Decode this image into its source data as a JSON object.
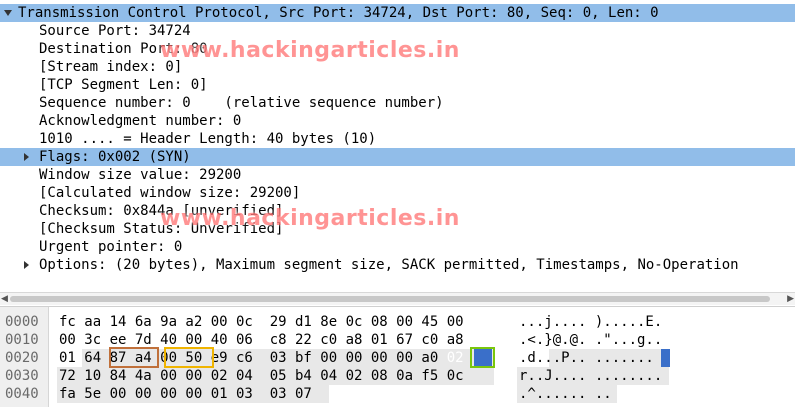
{
  "tree": {
    "rows": [
      {
        "text": "Transmission Control Protocol, Src Port: 34724, Dst Port: 80, Seq: 0, Len: 0",
        "expander": "expanded"
      },
      {
        "text": "Source Port: 34724"
      },
      {
        "text": "Destination Port: 80"
      },
      {
        "text": "[Stream index: 0]"
      },
      {
        "text": "[TCP Segment Len: 0]"
      },
      {
        "text": "Sequence number: 0    (relative sequence number)"
      },
      {
        "text": "Acknowledgment number: 0"
      },
      {
        "text": "1010 .... = Header Length: 40 bytes (10)"
      },
      {
        "text": "Flags: 0x002 (SYN)",
        "expander": "collapsed"
      },
      {
        "text": "Window size value: 29200"
      },
      {
        "text": "[Calculated window size: 29200]"
      },
      {
        "text": "Checksum: 0x844a [unverified]"
      },
      {
        "text": "[Checksum Status: Unverified]"
      },
      {
        "text": "Urgent pointer: 0"
      },
      {
        "text": "Options: (20 bytes), Maximum segment size, SACK permitted, Timestamps, No-Operation",
        "expander": "collapsed"
      }
    ],
    "watermark": "www.hackingarticles.in"
  },
  "hex": {
    "rows": [
      {
        "offset": "0000",
        "bytes": "fc aa 14 6a 9a a2 00 0c  29 d1 8e 0c 08 00 45 00",
        "ascii": "...j.... ).....E."
      },
      {
        "offset": "0010",
        "bytes": "00 3c ee 7d 40 00 40 06  c8 22 c0 a8 01 67 c0 a8",
        "ascii": ".<.}@.@. .\"...g.."
      },
      {
        "offset": "0020",
        "bytes": "01 64 87 a4 00 50 e9 c6  03 bf 00 00 00 00 a0 02",
        "ascii": ".d...P.. ......."
      },
      {
        "offset": "0030",
        "bytes": "72 10 84 4a 00 00 02 04  05 b4 04 02 08 0a f5 0c",
        "ascii": "r..J.... ........"
      },
      {
        "offset": "0040",
        "bytes": "fa 5e 00 00 00 00 01 03  03 07",
        "ascii": ".^...... .."
      }
    ],
    "selected_ascii_char": "."
  },
  "colors": {
    "selection": "#91bde9",
    "srcport_box": "#c0703a",
    "dstport_box": "#f0b400",
    "flags_box": "#7ac70c",
    "flags_fill": "#3a6fc9",
    "watermark": "#ff3c3c"
  }
}
